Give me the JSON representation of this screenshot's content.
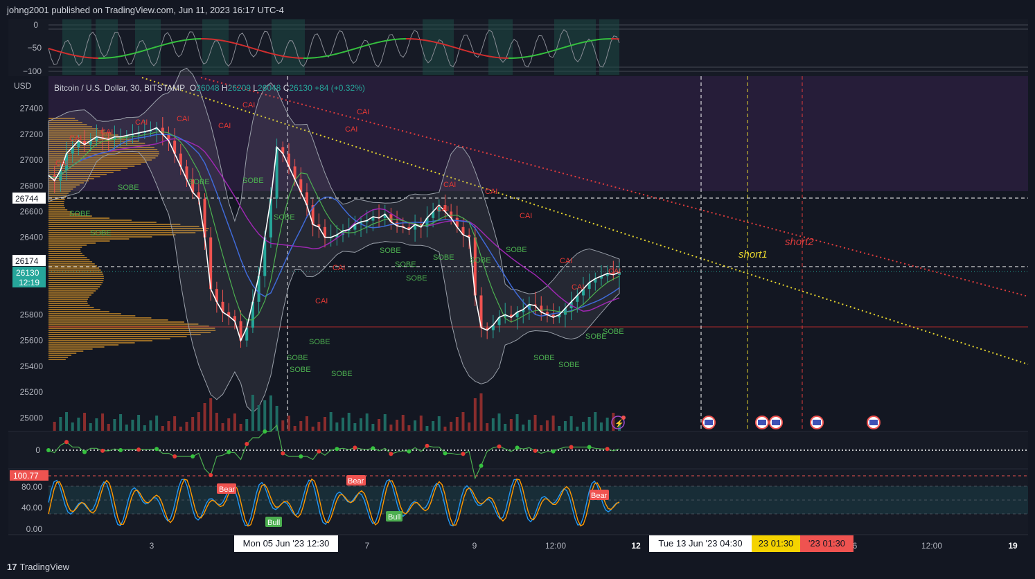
{
  "header": {
    "published": "johng2001 published on TradingView.com, Jun 11, 2023 16:17 UTC-4"
  },
  "legend": {
    "currency": "USD",
    "symbol": "Bitcoin / U.S. Dollar, 30, BITSTAMP",
    "o_label": "O",
    "o": "26048",
    "h_label": "H",
    "h": "26209",
    "l_label": "L",
    "l": "26048",
    "c_label": "C",
    "c": "26130",
    "change": "+84 (+0.32%)"
  },
  "price_axis": {
    "ticks": [
      "27400",
      "27200",
      "27000",
      "26800",
      "26600",
      "26400",
      "25800",
      "25600",
      "25400",
      "25200",
      "25000"
    ],
    "line_label_1": "26744",
    "line_label_2": "26174",
    "current_price": "26130",
    "countdown": "12:19"
  },
  "top_oscillator": {
    "ticks": [
      "0",
      "−50",
      "−100"
    ]
  },
  "mid_oscillator": {
    "ticks": [
      "0"
    ]
  },
  "stoch_oscillator": {
    "ticks": [
      "80.00",
      "40.00",
      "0.00"
    ],
    "value_label": "100.77",
    "signals": [
      "Bear",
      "Bear",
      "Bull",
      "Bull",
      "Bear"
    ]
  },
  "time_axis": {
    "ticks": [
      "3",
      "7",
      "9",
      "12:00",
      "12",
      "6",
      "12:00",
      "19"
    ],
    "crosshair_date": "Mon 05 Jun '23   12:30",
    "marker_dates": [
      "Tue 13 Jun '23   04:30",
      "23   01:30",
      "'23   01:30"
    ]
  },
  "annotations": {
    "short1": "short1",
    "short2": "short2",
    "signal_sell": "CAI",
    "signal_buy": "SOBE"
  },
  "footer": {
    "brand": "TradingView",
    "logo_mark": "17"
  },
  "colors": {
    "background": "#131722",
    "purple_zone": "#2a1f3d",
    "up": "#26a69a",
    "down": "#ef5350",
    "short1_line": "#e6d52e",
    "short2_line": "#e03c3c",
    "signal_sell": "#e53935",
    "signal_buy": "#4caf50"
  },
  "chart_data": {
    "type": "line",
    "title": "Bitcoin / U.S. Dollar, 30, BITSTAMP",
    "xlabel": "",
    "ylabel": "USD",
    "ylim": [
      24900,
      27650
    ],
    "x": [
      0,
      8,
      16,
      24,
      32,
      40,
      48,
      56,
      64,
      72,
      80,
      88,
      96,
      104,
      112,
      120,
      128,
      136,
      144,
      152,
      160,
      168,
      176,
      184,
      192,
      200,
      208,
      216,
      224,
      232,
      240,
      248,
      256,
      264,
      272,
      280,
      288,
      296,
      304,
      312,
      320,
      328,
      336,
      344,
      352,
      360,
      368,
      376,
      384,
      392,
      400,
      408,
      416,
      424,
      432,
      440,
      448,
      456,
      464,
      472,
      480,
      488,
      496,
      504,
      512,
      520,
      528,
      536,
      544,
      552,
      560,
      568,
      576,
      584,
      592,
      600,
      608,
      616,
      624,
      632,
      640,
      648,
      656,
      664,
      672,
      680,
      688,
      696,
      704,
      712,
      720,
      728,
      736,
      744,
      752,
      760,
      768,
      776,
      784,
      792,
      800,
      808,
      816,
      824
    ],
    "series": [
      {
        "values": [
          26880,
          26840,
          26920,
          27050,
          27100,
          27150,
          27120,
          27150,
          27180,
          27170,
          27160,
          27180,
          27180,
          27190,
          27200,
          27210,
          27220,
          27230,
          27250,
          27200,
          27150,
          27050,
          26950,
          26850,
          26750,
          26700,
          26400,
          26000,
          25900,
          25820,
          25790,
          25750,
          25600,
          25700,
          25900,
          26100,
          26400,
          26700,
          27100,
          27050,
          26950,
          26850,
          26750,
          26650,
          26500,
          26480,
          26400,
          26400,
          26420,
          26450,
          26460,
          26500,
          26520,
          26530,
          26560,
          26550,
          26580,
          26520,
          26490,
          26480,
          26460,
          26500,
          26480,
          26550,
          26600,
          26650,
          26600,
          26550,
          26480,
          26420,
          26400,
          25950,
          25700,
          25680,
          25720,
          25780,
          25800,
          25780,
          25820,
          25840,
          25880,
          25870,
          25820,
          25800,
          25780,
          25800,
          25850,
          25900,
          25950,
          26000,
          26050,
          26080,
          26100,
          26120,
          26110,
          26130
        ]
      }
    ]
  }
}
